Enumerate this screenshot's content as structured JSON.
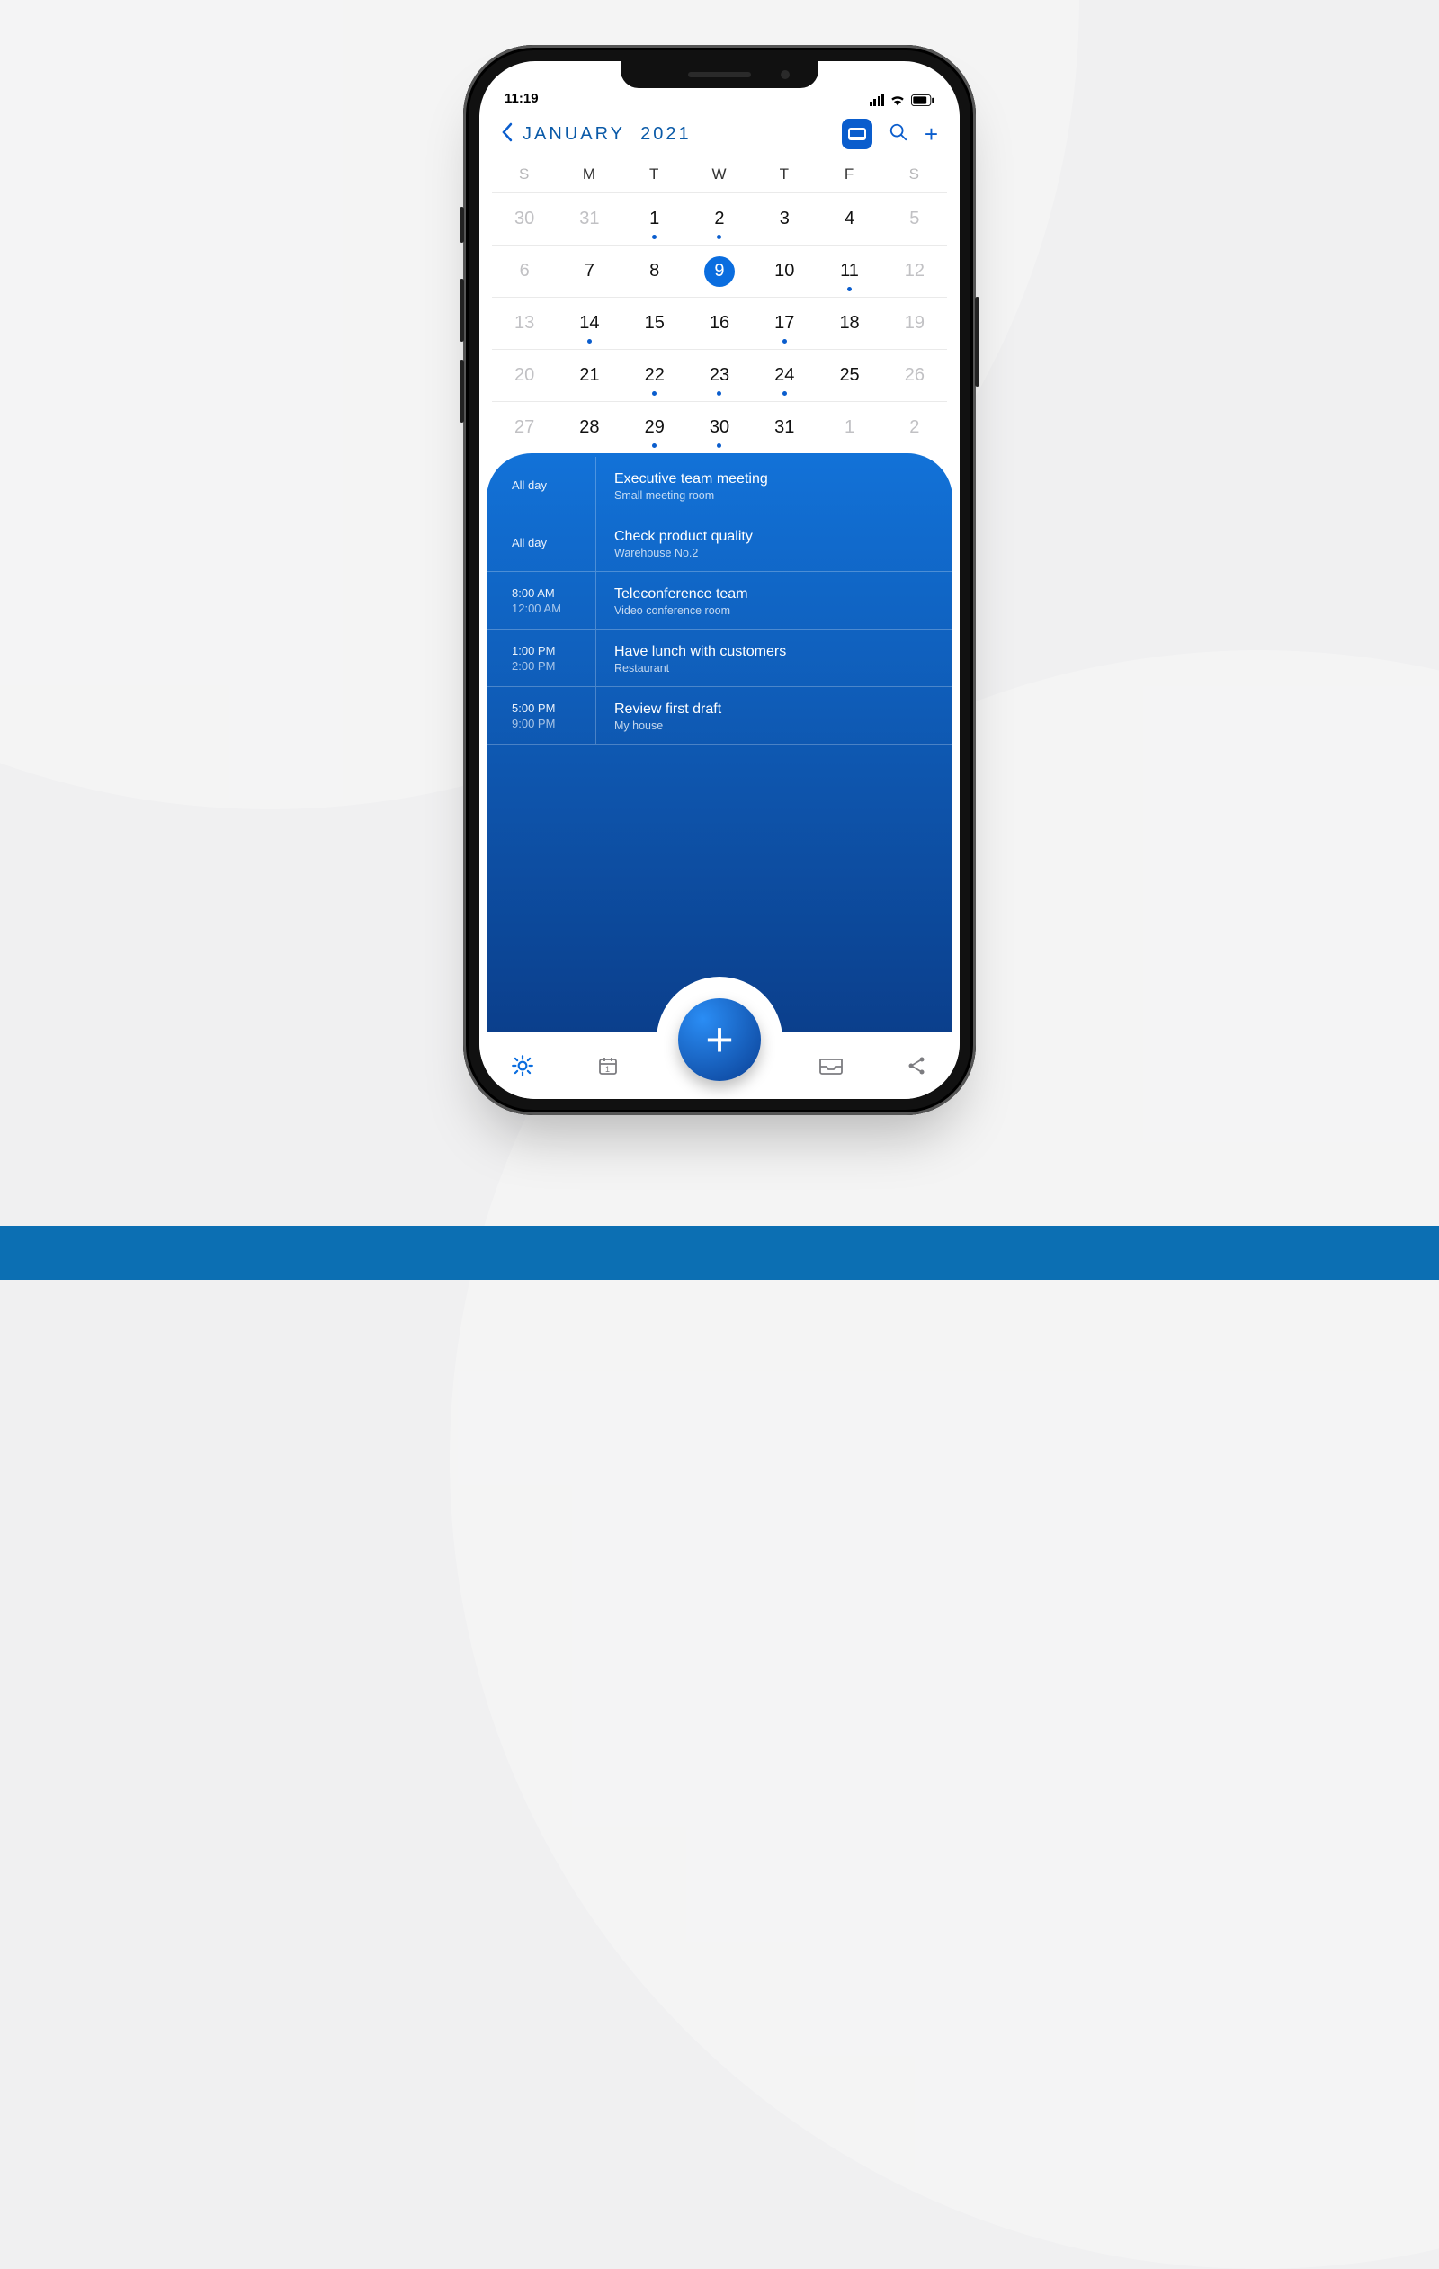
{
  "status": {
    "time": "11:19"
  },
  "header": {
    "month": "JANUARY",
    "year": "2021"
  },
  "calendar": {
    "weekdays": [
      "S",
      "M",
      "T",
      "W",
      "T",
      "F",
      "S"
    ],
    "grid": [
      [
        {
          "n": "30",
          "dim": true
        },
        {
          "n": "31",
          "dim": true
        },
        {
          "n": "1",
          "dot": true
        },
        {
          "n": "2",
          "dot": true
        },
        {
          "n": "3"
        },
        {
          "n": "4"
        },
        {
          "n": "5",
          "dim": true
        }
      ],
      [
        {
          "n": "6",
          "dim": true
        },
        {
          "n": "7"
        },
        {
          "n": "8"
        },
        {
          "n": "9",
          "sel": true
        },
        {
          "n": "10"
        },
        {
          "n": "11",
          "dot": true
        },
        {
          "n": "12",
          "dim": true
        }
      ],
      [
        {
          "n": "13",
          "dim": true
        },
        {
          "n": "14",
          "dot": true
        },
        {
          "n": "15"
        },
        {
          "n": "16"
        },
        {
          "n": "17",
          "dot": true
        },
        {
          "n": "18"
        },
        {
          "n": "19",
          "dim": true
        }
      ],
      [
        {
          "n": "20",
          "dim": true
        },
        {
          "n": "21"
        },
        {
          "n": "22",
          "dot": true
        },
        {
          "n": "23",
          "dot": true
        },
        {
          "n": "24",
          "dot": true
        },
        {
          "n": "25"
        },
        {
          "n": "26",
          "dim": true
        }
      ],
      [
        {
          "n": "27",
          "dim": true
        },
        {
          "n": "28"
        },
        {
          "n": "29",
          "dot": true
        },
        {
          "n": "30",
          "dot": true
        },
        {
          "n": "31"
        },
        {
          "n": "1",
          "dim": true
        },
        {
          "n": "2",
          "dim": true
        }
      ]
    ]
  },
  "events": [
    {
      "t1": "All day",
      "t2": "",
      "title": "Executive team meeting",
      "loc": "Small meeting room"
    },
    {
      "t1": "All day",
      "t2": "",
      "title": "Check product quality",
      "loc": "Warehouse  No.2"
    },
    {
      "t1": "8:00 AM",
      "t2": "12:00 AM",
      "title": "Teleconference team",
      "loc": "Video conference room"
    },
    {
      "t1": "1:00 PM",
      "t2": "2:00 PM",
      "title": "Have lunch with customers",
      "loc": "Restaurant"
    },
    {
      "t1": "5:00 PM",
      "t2": "9:00 PM",
      "title": "Review first draft",
      "loc": "My house"
    }
  ]
}
